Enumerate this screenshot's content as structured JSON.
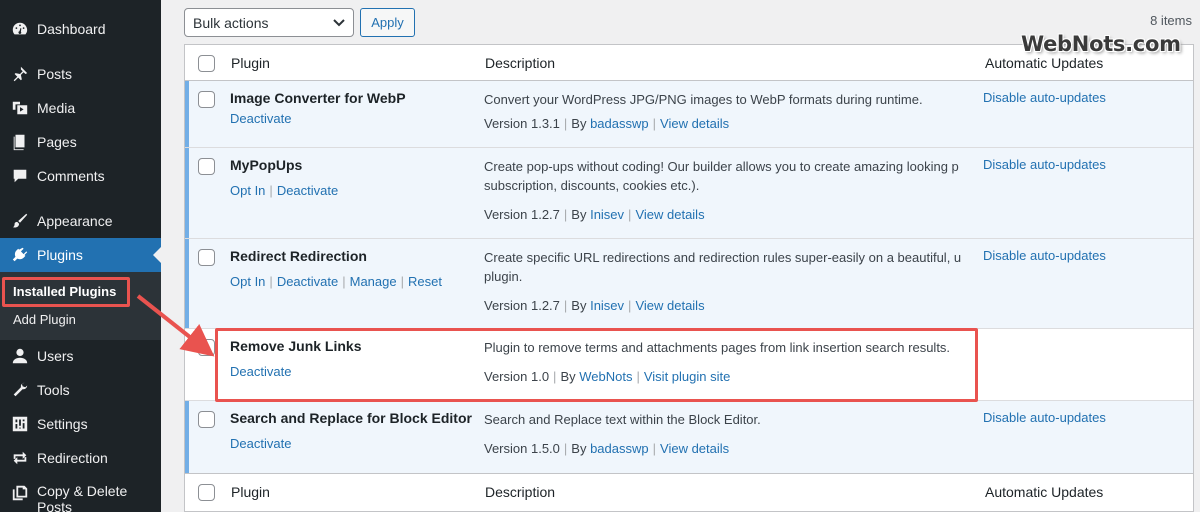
{
  "sidebar": {
    "items": [
      {
        "label": "Dashboard",
        "icon": "dashboard-icon"
      },
      {
        "label": "Posts",
        "icon": "pin-icon"
      },
      {
        "label": "Media",
        "icon": "media-icon"
      },
      {
        "label": "Pages",
        "icon": "pages-icon"
      },
      {
        "label": "Comments",
        "icon": "comments-icon"
      },
      {
        "label": "Appearance",
        "icon": "brush-icon"
      },
      {
        "label": "Plugins",
        "icon": "plugin-icon"
      },
      {
        "label": "Users",
        "icon": "users-icon"
      },
      {
        "label": "Tools",
        "icon": "wrench-icon"
      },
      {
        "label": "Settings",
        "icon": "settings-icon"
      },
      {
        "label": "Redirection",
        "icon": "redirect-icon"
      },
      {
        "label": "Copy & Delete Posts",
        "icon": "copy-icon"
      }
    ],
    "submenu": {
      "installed": "Installed Plugins",
      "add": "Add Plugin"
    }
  },
  "toolbar": {
    "bulk_actions": "Bulk actions",
    "apply": "Apply",
    "item_count": "8 items"
  },
  "table": {
    "columns": {
      "plugin": "Plugin",
      "description": "Description",
      "auto_updates": "Automatic Updates"
    },
    "rows": [
      {
        "name": "Image Converter for WebP",
        "actions": [
          "Deactivate"
        ],
        "description": [
          "Convert your WordPress JPG/PNG images to WebP formats during runtime."
        ],
        "version": "Version 1.3.1",
        "by_label": "By",
        "author": "badasswp",
        "details": "View details",
        "auto_update": "Disable auto-updates"
      },
      {
        "name": "MyPopUps",
        "actions": [
          "Opt In",
          "Deactivate"
        ],
        "description": [
          "Create pop-ups without coding! Our builder allows you to create amazing looking p",
          "subscription, discounts, cookies etc.)."
        ],
        "version": "Version 1.2.7",
        "by_label": "By",
        "author": "Inisev",
        "details": "View details",
        "auto_update": "Disable auto-updates"
      },
      {
        "name": "Redirect Redirection",
        "actions": [
          "Opt In",
          "Deactivate",
          "Manage",
          "Reset"
        ],
        "description": [
          "Create specific URL redirections and redirection rules super-easily on a beautiful, u",
          "plugin."
        ],
        "version": "Version 1.2.7",
        "by_label": "By",
        "author": "Inisev",
        "details": "View details",
        "auto_update": "Disable auto-updates"
      },
      {
        "name": "Remove Junk Links",
        "actions": [
          "Deactivate"
        ],
        "description": [
          "Plugin to remove terms and attachments pages from link insertion search results."
        ],
        "version": "Version 1.0",
        "by_label": "By",
        "author": "WebNots",
        "details": "Visit plugin site",
        "auto_update": ""
      },
      {
        "name": "Search and Replace for Block Editor",
        "actions": [
          "Deactivate"
        ],
        "description": [
          "Search and Replace text within the Block Editor."
        ],
        "version": "Version 1.5.0",
        "by_label": "By",
        "author": "badasswp",
        "details": "View details",
        "auto_update": "Disable auto-updates"
      }
    ]
  },
  "watermark": "WebNots.com",
  "colors": {
    "accent": "#2271b1",
    "highlight": "#e9534f",
    "sidebar": "#1d2327",
    "active_stripe": "#72aee6"
  }
}
